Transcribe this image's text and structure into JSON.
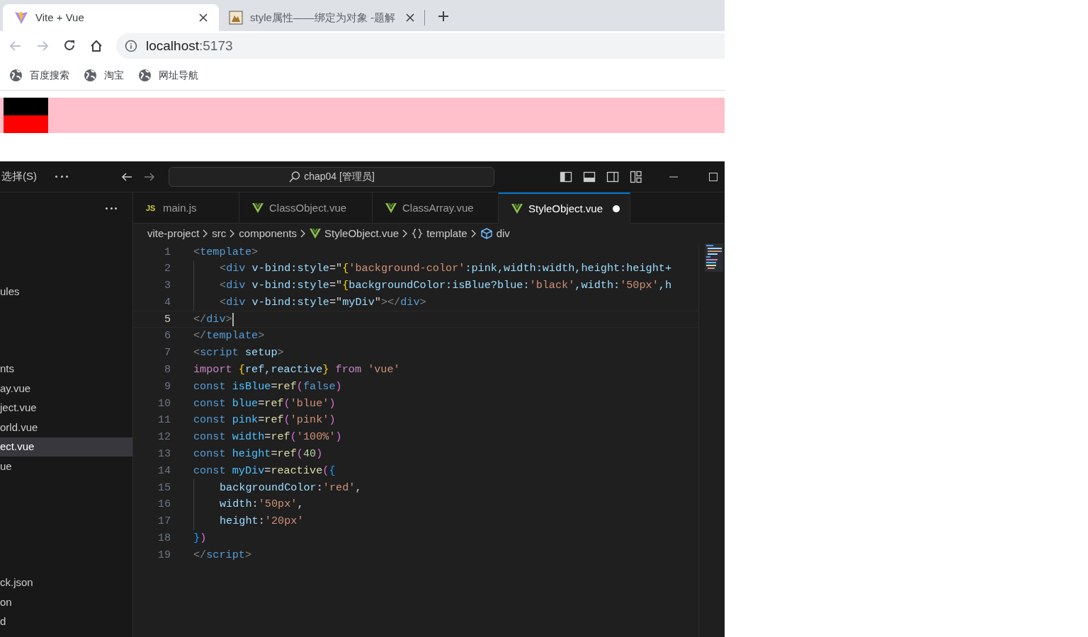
{
  "browser": {
    "tabs": [
      {
        "title": "Vite + Vue",
        "kind": "vite",
        "selected": true
      },
      {
        "title": "style属性——绑定为对象 -题解",
        "kind": "image",
        "selected": false
      }
    ],
    "address": {
      "host": "localhost",
      "port": ":5173"
    },
    "bookmarks": [
      "百度搜索",
      "淘宝",
      "网址导航"
    ]
  },
  "editor_window": {
    "menu": "选择(S)",
    "search": "chap04 [管理员]",
    "explorer": {
      "groups": [
        [
          {
            "label": "ules",
            "selected": false
          }
        ],
        [
          {
            "label": "nts",
            "selected": false
          },
          {
            "label": "ay.vue",
            "selected": false
          },
          {
            "label": "ject.vue",
            "selected": false
          },
          {
            "label": "orld.vue",
            "selected": false
          },
          {
            "label": "ect.vue",
            "selected": true
          },
          {
            "label": "ue",
            "selected": false
          }
        ],
        [
          {
            "label": "ck.json",
            "selected": false
          },
          {
            "label": "on",
            "selected": false
          },
          {
            "label": "d",
            "selected": false
          }
        ]
      ]
    },
    "tabs": [
      {
        "title": "main.js",
        "kind": "js",
        "badge": "JS",
        "selected": false,
        "modified": false
      },
      {
        "title": "ClassObject.vue",
        "kind": "vue",
        "selected": false,
        "modified": false
      },
      {
        "title": "ClassArray.vue",
        "kind": "vue",
        "selected": false,
        "modified": false
      },
      {
        "title": "StyleObject.vue",
        "kind": "vue",
        "selected": true,
        "modified": true
      }
    ],
    "breadcrumbs": [
      {
        "label": "vite-project",
        "kind": "folder"
      },
      {
        "label": "src",
        "kind": "folder"
      },
      {
        "label": "components",
        "kind": "folder"
      },
      {
        "label": "StyleObject.vue",
        "kind": "vue"
      },
      {
        "label": "template",
        "kind": "braces"
      },
      {
        "label": "div",
        "kind": "element"
      }
    ],
    "lines": [
      {
        "number": "1",
        "indented": false,
        "current": false,
        "tokens": [
          {
            "kind": "p",
            "text": "<"
          },
          {
            "kind": "tag",
            "text": "template"
          },
          {
            "kind": "p",
            "text": ">"
          }
        ]
      },
      {
        "number": "2",
        "indented": true,
        "current": false,
        "tokens": [
          {
            "kind": "p",
            "text": "<"
          },
          {
            "kind": "tag",
            "text": "div"
          },
          {
            "kind": "attr",
            "text": " v-bind:style"
          },
          {
            "kind": "plain",
            "text": "=\""
          },
          {
            "kind": "brace",
            "text": "{"
          },
          {
            "kind": "str",
            "text": "'background-color'"
          },
          {
            "kind": "var",
            "text": ":pink,width:width,height:height+"
          }
        ]
      },
      {
        "number": "3",
        "indented": true,
        "current": false,
        "tokens": [
          {
            "kind": "p",
            "text": "<"
          },
          {
            "kind": "tag",
            "text": "div"
          },
          {
            "kind": "attr",
            "text": " v-bind:style"
          },
          {
            "kind": "plain",
            "text": "=\""
          },
          {
            "kind": "brace",
            "text": "{"
          },
          {
            "kind": "var",
            "text": "backgroundColor:isBlue?blue:"
          },
          {
            "kind": "str",
            "text": "'black'"
          },
          {
            "kind": "var",
            "text": ",width:"
          },
          {
            "kind": "str",
            "text": "'50px'"
          },
          {
            "kind": "var",
            "text": ",h"
          }
        ]
      },
      {
        "number": "4",
        "indented": true,
        "current": false,
        "tokens": [
          {
            "kind": "p",
            "text": "<"
          },
          {
            "kind": "tag",
            "text": "div"
          },
          {
            "kind": "attr",
            "text": " v-bind:style"
          },
          {
            "kind": "plain",
            "text": "=\""
          },
          {
            "kind": "var",
            "text": "myDiv"
          },
          {
            "kind": "plain",
            "text": "\""
          },
          {
            "kind": "p",
            "text": "></"
          },
          {
            "kind": "tag",
            "text": "div"
          },
          {
            "kind": "p",
            "text": ">"
          }
        ]
      },
      {
        "number": "5",
        "indented": false,
        "current": true,
        "tokens": [
          {
            "kind": "p",
            "text": "</"
          },
          {
            "kind": "tag",
            "text": "div"
          },
          {
            "kind": "p",
            "text": ">"
          }
        ]
      },
      {
        "number": "6",
        "indented": false,
        "current": false,
        "tokens": [
          {
            "kind": "p",
            "text": "</"
          },
          {
            "kind": "tag",
            "text": "template"
          },
          {
            "kind": "p",
            "text": ">"
          }
        ]
      },
      {
        "number": "7",
        "indented": false,
        "current": false,
        "tokens": [
          {
            "kind": "p",
            "text": "<"
          },
          {
            "kind": "tag",
            "text": "script"
          },
          {
            "kind": "attr",
            "text": " setup"
          },
          {
            "kind": "p",
            "text": ">"
          }
        ]
      },
      {
        "number": "8",
        "indented": false,
        "current": false,
        "tokens": [
          {
            "kind": "kw2",
            "text": "import "
          },
          {
            "kind": "brace",
            "text": "{"
          },
          {
            "kind": "var",
            "text": "ref,reactive"
          },
          {
            "kind": "brace",
            "text": "}"
          },
          {
            "kind": "kw2",
            "text": " from "
          },
          {
            "kind": "str",
            "text": "'vue'"
          }
        ]
      },
      {
        "number": "9",
        "indented": false,
        "current": false,
        "tokens": [
          {
            "kind": "kw",
            "text": "const "
          },
          {
            "kind": "const",
            "text": "isBlue"
          },
          {
            "kind": "plain",
            "text": "="
          },
          {
            "kind": "func",
            "text": "ref"
          },
          {
            "kind": "paren",
            "text": "("
          },
          {
            "kind": "kw",
            "text": "false"
          },
          {
            "kind": "paren",
            "text": ")"
          }
        ]
      },
      {
        "number": "10",
        "indented": false,
        "current": false,
        "tokens": [
          {
            "kind": "kw",
            "text": "const "
          },
          {
            "kind": "const",
            "text": "blue"
          },
          {
            "kind": "plain",
            "text": "="
          },
          {
            "kind": "func",
            "text": "ref"
          },
          {
            "kind": "paren",
            "text": "("
          },
          {
            "kind": "str",
            "text": "'blue'"
          },
          {
            "kind": "paren",
            "text": ")"
          }
        ]
      },
      {
        "number": "11",
        "indented": false,
        "current": false,
        "tokens": [
          {
            "kind": "kw",
            "text": "const "
          },
          {
            "kind": "const",
            "text": "pink"
          },
          {
            "kind": "plain",
            "text": "="
          },
          {
            "kind": "func",
            "text": "ref"
          },
          {
            "kind": "paren",
            "text": "("
          },
          {
            "kind": "str",
            "text": "'pink'"
          },
          {
            "kind": "paren",
            "text": ")"
          }
        ]
      },
      {
        "number": "12",
        "indented": false,
        "current": false,
        "tokens": [
          {
            "kind": "kw",
            "text": "const "
          },
          {
            "kind": "const",
            "text": "width"
          },
          {
            "kind": "plain",
            "text": "="
          },
          {
            "kind": "func",
            "text": "ref"
          },
          {
            "kind": "paren",
            "text": "("
          },
          {
            "kind": "str",
            "text": "'100%'"
          },
          {
            "kind": "paren",
            "text": ")"
          }
        ]
      },
      {
        "number": "13",
        "indented": false,
        "current": false,
        "tokens": [
          {
            "kind": "kw",
            "text": "const "
          },
          {
            "kind": "const",
            "text": "height"
          },
          {
            "kind": "plain",
            "text": "="
          },
          {
            "kind": "func",
            "text": "ref"
          },
          {
            "kind": "paren",
            "text": "("
          },
          {
            "kind": "num",
            "text": "40"
          },
          {
            "kind": "paren",
            "text": ")"
          }
        ]
      },
      {
        "number": "14",
        "indented": false,
        "current": false,
        "tokens": [
          {
            "kind": "kw",
            "text": "const "
          },
          {
            "kind": "const",
            "text": "myDiv"
          },
          {
            "kind": "plain",
            "text": "="
          },
          {
            "kind": "func",
            "text": "reactive"
          },
          {
            "kind": "paren",
            "text": "("
          },
          {
            "kind": "brace3",
            "text": "{"
          }
        ]
      },
      {
        "number": "15",
        "indented": true,
        "current": false,
        "tokens": [
          {
            "kind": "var",
            "text": "backgroundColor"
          },
          {
            "kind": "plain",
            "text": ":"
          },
          {
            "kind": "str",
            "text": "'red'"
          },
          {
            "kind": "plain",
            "text": ","
          }
        ]
      },
      {
        "number": "16",
        "indented": true,
        "current": false,
        "tokens": [
          {
            "kind": "var",
            "text": "width"
          },
          {
            "kind": "plain",
            "text": ":"
          },
          {
            "kind": "str",
            "text": "'50px'"
          },
          {
            "kind": "plain",
            "text": ","
          }
        ]
      },
      {
        "number": "17",
        "indented": true,
        "current": false,
        "tokens": [
          {
            "kind": "var",
            "text": "height"
          },
          {
            "kind": "plain",
            "text": ":"
          },
          {
            "kind": "str",
            "text": "'20px'"
          }
        ]
      },
      {
        "number": "18",
        "indented": false,
        "current": false,
        "tokens": [
          {
            "kind": "brace3",
            "text": "}"
          },
          {
            "kind": "paren",
            "text": ")"
          }
        ]
      },
      {
        "number": "19",
        "indented": false,
        "current": false,
        "tokens": [
          {
            "kind": "p",
            "text": "</"
          },
          {
            "kind": "tag",
            "text": "script"
          },
          {
            "kind": "p",
            "text": ">"
          }
        ]
      }
    ]
  }
}
